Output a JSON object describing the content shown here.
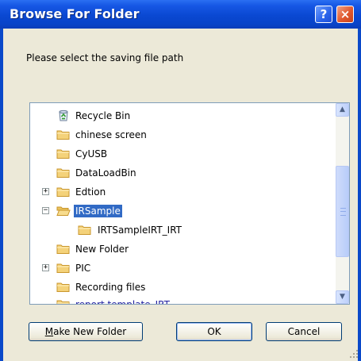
{
  "window": {
    "title": "Browse For Folder",
    "help_glyph": "?",
    "close_glyph": "×"
  },
  "prompt": "Please select the saving file path",
  "tree": {
    "items": [
      {
        "label": "Recycle Bin",
        "icon": "recycle-bin-icon"
      },
      {
        "label": "chinese screen",
        "icon": "folder-icon"
      },
      {
        "label": "CyUSB",
        "icon": "folder-icon"
      },
      {
        "label": "DataLoadBin",
        "icon": "folder-icon"
      },
      {
        "label": "Edtion",
        "icon": "folder-icon",
        "expander": "+"
      },
      {
        "label": "IRSample",
        "icon": "open-folder-icon",
        "expander": "−",
        "selected": true
      },
      {
        "label": "IRTSampleIRT_IRT",
        "icon": "folder-icon"
      },
      {
        "label": "New Folder",
        "icon": "folder-icon"
      },
      {
        "label": "PIC",
        "icon": "folder-icon",
        "expander": "+"
      },
      {
        "label": "Recording files",
        "icon": "folder-icon"
      },
      {
        "label": "report template_IRT",
        "icon": "folder-icon"
      }
    ]
  },
  "buttons": {
    "make_new_folder": "Make New Folder",
    "ok": "OK",
    "cancel": "Cancel"
  },
  "colors": {
    "titlebar": "#0a48d2",
    "selection": "#316ac5",
    "dialog_face": "#ece9d8"
  }
}
